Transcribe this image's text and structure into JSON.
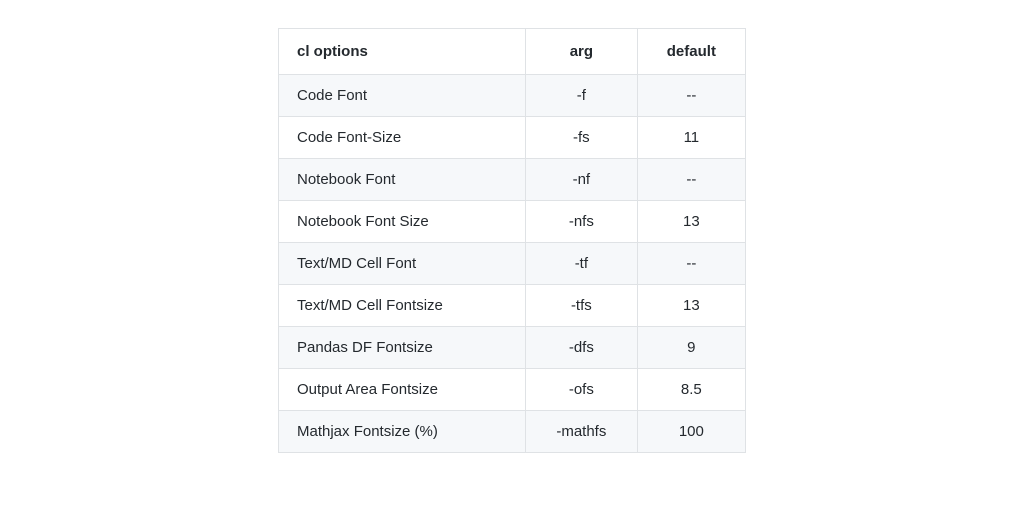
{
  "table": {
    "headers": {
      "options": "cl options",
      "arg": "arg",
      "default": "default"
    },
    "rows": [
      {
        "option": "Code Font",
        "arg": "-f",
        "default": "--"
      },
      {
        "option": "Code Font-Size",
        "arg": "-fs",
        "default": "11"
      },
      {
        "option": "Notebook Font",
        "arg": "-nf",
        "default": "--"
      },
      {
        "option": "Notebook Font Size",
        "arg": "-nfs",
        "default": "13"
      },
      {
        "option": "Text/MD Cell Font",
        "arg": "-tf",
        "default": "--"
      },
      {
        "option": "Text/MD Cell Fontsize",
        "arg": "-tfs",
        "default": "13"
      },
      {
        "option": "Pandas DF Fontsize",
        "arg": "-dfs",
        "default": "9"
      },
      {
        "option": "Output Area Fontsize",
        "arg": "-ofs",
        "default": "8.5"
      },
      {
        "option": "Mathjax Fontsize (%)",
        "arg": "-mathfs",
        "default": "100"
      }
    ]
  }
}
